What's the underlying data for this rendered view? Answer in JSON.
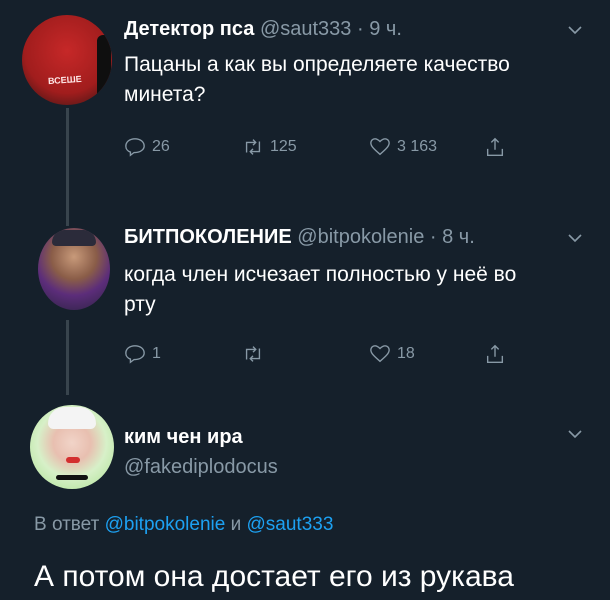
{
  "tweets": [
    {
      "name": "Детектор пса",
      "handle": "@saut333",
      "time": "9 ч.",
      "text_line1": "Пацаны а как вы определяете качество",
      "text_line2": "минета?",
      "replies": "26",
      "retweets": "125",
      "likes": "3 163",
      "avatar_text": "ВСЕШЕ"
    },
    {
      "name": "БИТПОКОЛЕНИЕ",
      "handle": "@bitpokolenie",
      "time": "8 ч.",
      "text_line1": "когда член исчезает полностью у неё во",
      "text_line2": "рту",
      "replies": "1",
      "retweets": "",
      "likes": "18"
    },
    {
      "name": "ким чен ира",
      "handle": "@fakediplodocus",
      "reply_prefix": "В ответ",
      "reply_user1": "@bitpokolenie",
      "reply_and": "и",
      "reply_user2": "@saut333",
      "text": "А потом она достает его из рукава"
    }
  ],
  "separator": "·",
  "icons": [
    "reply-icon",
    "retweet-icon",
    "like-icon",
    "share-icon",
    "chevron-down-icon"
  ],
  "colors": {
    "background": "#15202b",
    "muted": "#8899a6",
    "link": "#1da1f2",
    "line": "#38444d"
  }
}
